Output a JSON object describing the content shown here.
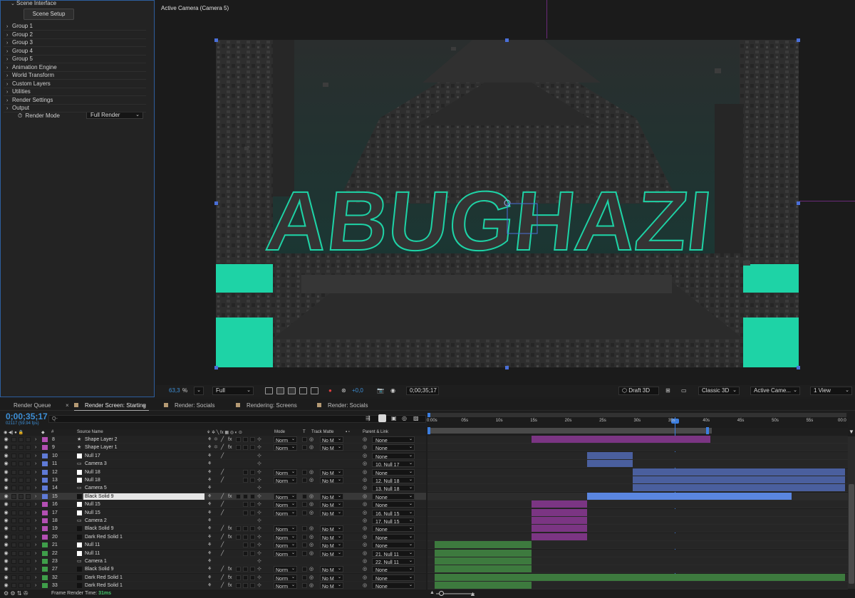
{
  "effect_controls": {
    "section_title": "Scene Interface",
    "scene_setup_label": "Scene Setup",
    "groups": [
      "Group 1",
      "Group 2",
      "Group 3",
      "Group 4",
      "Group 5",
      "Animation Engine",
      "World Transform",
      "Custom Layers",
      "Utilities",
      "Render Settings",
      "Output"
    ],
    "render_mode_label": "Render Mode",
    "render_mode_value": "Full Render"
  },
  "viewer": {
    "title": "Active Camera (Camera 5)",
    "render_text": "ABUGHAZI",
    "toolbar": {
      "zoom": "63,3",
      "zoom_unit": "%",
      "resolution": "Full",
      "exposure": "+0,0",
      "timecode": "0;00;35;17",
      "renderer": "Draft 3D",
      "renderer_mode": "Classic 3D",
      "camera_view": "Active Came...",
      "view_count": "1 View"
    },
    "colors": {
      "accent_teal": "#1ed3a6",
      "handle_blue": "#4a6fd8"
    }
  },
  "tabs": {
    "render_queue": "Render Queue",
    "render_screen_starting": "Render Screen: Starting",
    "render_socials_1": "Render: Socials",
    "rendering_screens": "Rendering: Screens",
    "render_socials_2": "Render: Socials"
  },
  "timeline": {
    "current_time": "0;00;35;17",
    "frame_info": "02117 (59.94 fps)",
    "search_placeholder": "Q-",
    "columns": {
      "num": "#",
      "source_name": "Source Name",
      "mode": "Mode",
      "t": "T",
      "track_matte": "Track Matte",
      "parent_link": "Parent & Link"
    },
    "ruler_labels": [
      "0:00s",
      "05s",
      "10s",
      "15s",
      "20s",
      "25s",
      "30s",
      "35s",
      "40s",
      "45s",
      "50s",
      "55s",
      "00:0"
    ],
    "ruler_max_seconds": 60,
    "current_seconds": 35.28,
    "work_area_seconds": [
      0,
      40.7
    ],
    "layers": [
      {
        "num": "8",
        "name": "Shape Layer 2",
        "type": "shape",
        "label": "#b34fb3",
        "mode": "Norm",
        "matte": "No M",
        "parent": "None",
        "fx": true,
        "bar": [
          14.6,
          40.5
        ],
        "bar_color": "#7b3583"
      },
      {
        "num": "9",
        "name": "Shape Layer 1",
        "type": "shape",
        "label": "#b34fb3",
        "mode": "Norm",
        "matte": "No M",
        "parent": "None",
        "fx": true,
        "bar": null
      },
      {
        "num": "10",
        "name": "Null 17",
        "type": "null",
        "label": "#5f7ad6",
        "mode": "",
        "matte": "",
        "parent": "None",
        "fx": false,
        "bar": [
          22.6,
          29.2
        ],
        "bar_color": "#4a5f9e"
      },
      {
        "num": "11",
        "name": "Camera 3",
        "type": "camera",
        "label": "#5f7ad6",
        "mode": "",
        "matte": "",
        "parent": "10. Null 17",
        "fx": false,
        "bar": [
          22.6,
          29.2
        ],
        "bar_color": "#4a5f9e"
      },
      {
        "num": "12",
        "name": "Null 18",
        "type": "null",
        "label": "#5f7ad6",
        "mode": "Norm",
        "matte": "No M",
        "parent": "None",
        "fx": false,
        "bar": [
          29.2,
          60
        ],
        "bar_color": "#4a5f9e"
      },
      {
        "num": "13",
        "name": "Null 18",
        "type": "null",
        "label": "#5f7ad6",
        "mode": "Norm",
        "matte": "No M",
        "parent": "12. Null 18",
        "fx": false,
        "bar": [
          29.2,
          60
        ],
        "bar_color": "#4a5f9e"
      },
      {
        "num": "14",
        "name": "Camera 5",
        "type": "camera",
        "label": "#5f7ad6",
        "mode": "",
        "matte": "",
        "parent": "13. Null 18",
        "fx": false,
        "bar": [
          29.2,
          60
        ],
        "bar_color": "#4a5f9e"
      },
      {
        "num": "15",
        "name": "Black Solid 9",
        "type": "solid",
        "label": "#5f7ad6",
        "mode": "Norm",
        "matte": "No M",
        "parent": "None",
        "fx": true,
        "bar": [
          22.6,
          52.3
        ],
        "bar_color": "#5a86e0",
        "selected": true
      },
      {
        "num": "16",
        "name": "Null 15",
        "type": "null",
        "label": "#b34fb3",
        "mode": "Norm",
        "matte": "No M",
        "parent": "None",
        "fx": false,
        "bar": [
          14.6,
          22.6
        ],
        "bar_color": "#7b3583"
      },
      {
        "num": "17",
        "name": "Null 15",
        "type": "null",
        "label": "#b34fb3",
        "mode": "Norm",
        "matte": "No M",
        "parent": "16. Null 15",
        "fx": false,
        "bar": [
          14.6,
          22.6
        ],
        "bar_color": "#7b3583"
      },
      {
        "num": "18",
        "name": "Camera 2",
        "type": "camera",
        "label": "#b34fb3",
        "mode": "",
        "matte": "",
        "parent": "17. Null 15",
        "fx": false,
        "bar": [
          14.6,
          22.6
        ],
        "bar_color": "#7b3583"
      },
      {
        "num": "19",
        "name": "Black Solid 9",
        "type": "solid",
        "label": "#b34fb3",
        "mode": "Norm",
        "matte": "No M",
        "parent": "None",
        "fx": true,
        "bar": [
          14.6,
          22.6
        ],
        "bar_color": "#7b3583"
      },
      {
        "num": "20",
        "name": "Dark Red Solid 1",
        "type": "solid",
        "label": "#b34fb3",
        "mode": "Norm",
        "matte": "No M",
        "parent": "None",
        "fx": true,
        "bar": [
          14.6,
          22.6
        ],
        "bar_color": "#7b3583"
      },
      {
        "num": "21",
        "name": "Null 11",
        "type": "null",
        "label": "#3f9e4a",
        "mode": "Norm",
        "matte": "No M",
        "parent": "None",
        "fx": false,
        "bar": [
          0.5,
          14.6
        ],
        "bar_color": "#3d7a3e"
      },
      {
        "num": "22",
        "name": "Null 11",
        "type": "null",
        "label": "#3f9e4a",
        "mode": "Norm",
        "matte": "No M",
        "parent": "21. Null 11",
        "fx": false,
        "bar": [
          0.5,
          14.6
        ],
        "bar_color": "#3d7a3e"
      },
      {
        "num": "23",
        "name": "Camera 1",
        "type": "camera",
        "label": "#3f9e4a",
        "mode": "",
        "matte": "",
        "parent": "22. Null 11",
        "fx": false,
        "bar": [
          0.5,
          14.6
        ],
        "bar_color": "#3d7a3e"
      },
      {
        "num": "27",
        "name": "Black Solid 9",
        "type": "solid",
        "label": "#3f9e4a",
        "mode": "Norm",
        "matte": "No M",
        "parent": "None",
        "fx": true,
        "bar": [
          0.5,
          14.6
        ],
        "bar_color": "#3d7a3e"
      },
      {
        "num": "32",
        "name": "Dark Red Solid 1",
        "type": "solid",
        "label": "#3f9e4a",
        "mode": "Norm",
        "matte": "No M",
        "parent": "None",
        "fx": true,
        "bar": [
          0.5,
          60
        ],
        "bar_color": "#3d7a3e"
      },
      {
        "num": "33",
        "name": "Dark Red Solid 1",
        "type": "solid",
        "label": "#3f9e4a",
        "mode": "Norm",
        "matte": "No M",
        "parent": "None",
        "fx": true,
        "bar": [
          0.5,
          14.6
        ],
        "bar_color": "#3d7a3e"
      }
    ]
  },
  "status": {
    "frame_render_label": "Frame Render Time:",
    "frame_render_value": "31ms"
  }
}
